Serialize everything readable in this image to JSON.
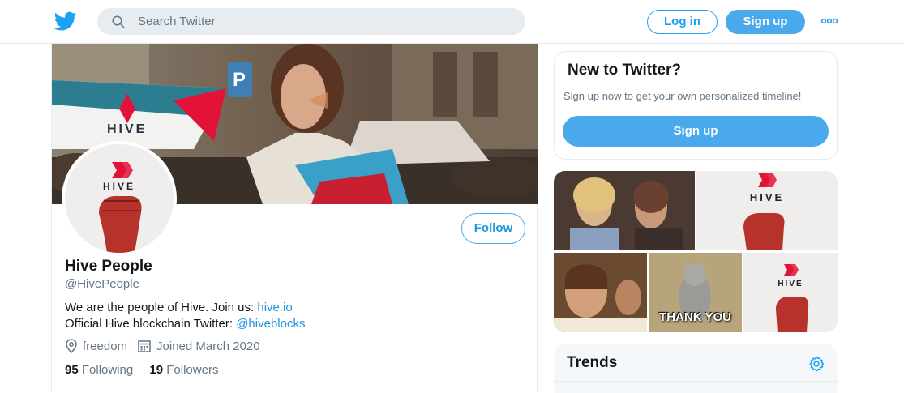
{
  "topbar": {
    "search_placeholder": "Search Twitter",
    "login_label": "Log in",
    "signup_label": "Sign up"
  },
  "profile": {
    "banner_text": "HIVE",
    "avatar_text": "HIVE",
    "follow_label": "Follow",
    "name": "Hive People",
    "handle": "@HivePeople",
    "bio_line1": "We are the people of Hive. Join us: ",
    "bio_link1": "hive.io",
    "bio_line2": "Official Hive blockchain Twitter: ",
    "bio_link2": "@hiveblocks",
    "location": "freedom",
    "joined": "Joined March 2020",
    "following_count": "95",
    "following_label": "Following",
    "followers_count": "19",
    "followers_label": "Followers"
  },
  "new_to_twitter": {
    "title": "New to Twitter?",
    "subtitle": "Sign up now to get your own personalized timeline!",
    "signup_label": "Sign up"
  },
  "media": {
    "hive_label": "HIVE",
    "thank_you": "THANK YOU"
  },
  "trends": {
    "title": "Trends"
  },
  "colors": {
    "accent": "#1da1f2",
    "button": "#4aa9ec",
    "hive_red": "#e31337"
  }
}
